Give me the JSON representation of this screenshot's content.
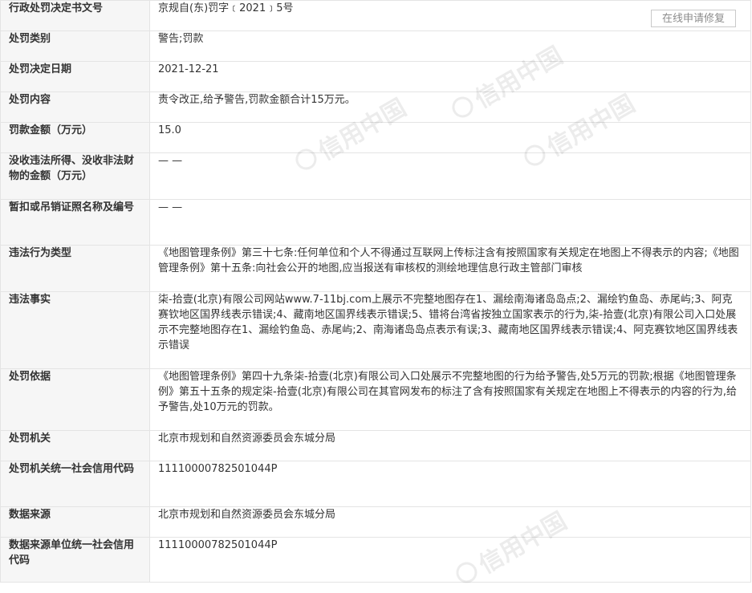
{
  "repair_button": "在线申请修复",
  "watermark_text": "信用中国",
  "rows": [
    {
      "label": "行政处罚决定书文号",
      "value": "京规自(东)罚字﹝2021﹞5号"
    },
    {
      "label": "处罚类别",
      "value": "警告;罚款"
    },
    {
      "label": "处罚决定日期",
      "value": "2021-12-21"
    },
    {
      "label": "处罚内容",
      "value": "责令改正,给予警告,罚款金额合计15万元。"
    },
    {
      "label": "罚款金额（万元）",
      "value": "15.0"
    },
    {
      "label": "没收违法所得、没收非法财物的金额（万元）",
      "value": "— —"
    },
    {
      "label": "暂扣或吊销证照名称及编号",
      "value": "— —"
    },
    {
      "label": "违法行为类型",
      "value": "《地图管理条例》第三十七条:任何单位和个人不得通过互联网上传标注含有按照国家有关规定在地图上不得表示的内容;《地图管理条例》第十五条:向社会公开的地图,应当报送有审核权的测绘地理信息行政主管部门审核"
    },
    {
      "label": "违法事实",
      "value": "柒-拾壹(北京)有限公司网站www.7-11bj.com上展示不完整地图存在1、漏绘南海诸岛岛点;2、漏绘钓鱼岛、赤尾屿;3、阿克赛钦地区国界线表示错误;4、藏南地区国界线表示错误;5、错将台湾省按独立国家表示的行为,柒-拾壹(北京)有限公司入口处展示不完整地图存在1、漏绘钓鱼岛、赤尾屿;2、南海诸岛岛点表示有误;3、藏南地区国界线表示错误;4、阿克赛钦地区国界线表示错误"
    },
    {
      "label": "处罚依据",
      "value": "《地图管理条例》第四十九条柒-拾壹(北京)有限公司入口处展示不完整地图的行为给予警告,处5万元的罚款;根据《地图管理条例》第五十五条的规定柒-拾壹(北京)有限公司在其官网发布的标注了含有按照国家有关规定在地图上不得表示的内容的行为,给予警告,处10万元的罚款。"
    },
    {
      "label": "处罚机关",
      "value": "北京市规划和自然资源委员会东城分局"
    },
    {
      "label": "处罚机关统一社会信用代码",
      "value": "11110000782501044P"
    },
    {
      "label": "数据来源",
      "value": "北京市规划和自然资源委员会东城分局"
    },
    {
      "label": "数据来源单位统一社会信用代码",
      "value": "11110000782501044P"
    }
  ]
}
